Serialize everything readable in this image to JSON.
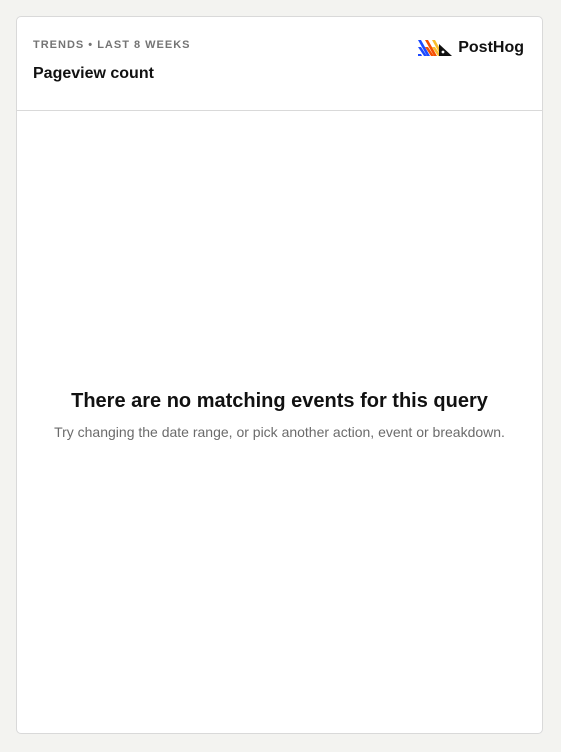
{
  "header": {
    "subtitle": "TRENDS • LAST 8 WEEKS",
    "title": "Pageview count"
  },
  "brand": {
    "name": "PostHog",
    "icon": "posthog-logo-icon"
  },
  "empty_state": {
    "title": "There are no matching events for this query",
    "description": "Try changing the date range, or pick another action, event or breakdown."
  },
  "colors": {
    "page_background": "#f3f3f0",
    "card_background": "#ffffff",
    "border": "#d9d9d9",
    "text_primary": "#111111",
    "text_muted": "#747474",
    "logo_blue": "#1d4aff",
    "logo_orange": "#f54e00",
    "logo_yellow": "#f9bd2b"
  }
}
